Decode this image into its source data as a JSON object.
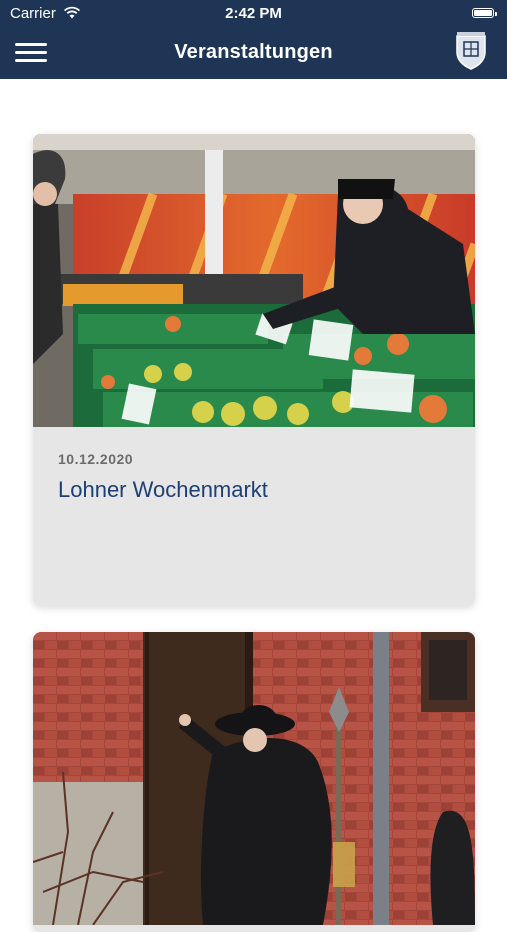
{
  "status_bar": {
    "carrier": "Carrier",
    "time": "2:42 PM"
  },
  "header": {
    "title": "Veranstaltungen",
    "menu_icon": "hamburger-menu-icon",
    "logo_icon": "coat-of-arms-icon"
  },
  "colors": {
    "header_bg": "#1e3556",
    "title_text": "#1e3f73",
    "card_bg": "#e6e6e6"
  },
  "events": [
    {
      "date": "10.12.2020",
      "title": "Lohner Wochenmarkt"
    },
    {
      "date": "",
      "title": ""
    }
  ]
}
